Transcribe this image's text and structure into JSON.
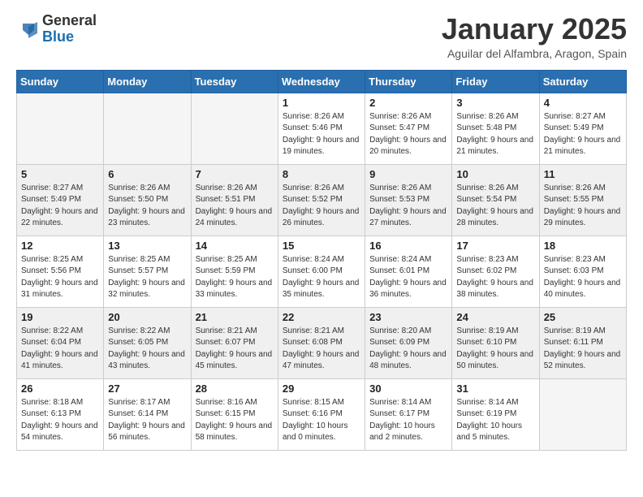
{
  "header": {
    "logo_general": "General",
    "logo_blue": "Blue",
    "month": "January 2025",
    "location": "Aguilar del Alfambra, Aragon, Spain"
  },
  "days_of_week": [
    "Sunday",
    "Monday",
    "Tuesday",
    "Wednesday",
    "Thursday",
    "Friday",
    "Saturday"
  ],
  "weeks": [
    [
      {
        "day": "",
        "empty": true
      },
      {
        "day": "",
        "empty": true
      },
      {
        "day": "",
        "empty": true
      },
      {
        "day": "1",
        "sunrise": "8:26 AM",
        "sunset": "5:46 PM",
        "daylight": "9 hours and 19 minutes."
      },
      {
        "day": "2",
        "sunrise": "8:26 AM",
        "sunset": "5:47 PM",
        "daylight": "9 hours and 20 minutes."
      },
      {
        "day": "3",
        "sunrise": "8:26 AM",
        "sunset": "5:48 PM",
        "daylight": "9 hours and 21 minutes."
      },
      {
        "day": "4",
        "sunrise": "8:27 AM",
        "sunset": "5:49 PM",
        "daylight": "9 hours and 21 minutes."
      }
    ],
    [
      {
        "day": "5",
        "sunrise": "8:27 AM",
        "sunset": "5:49 PM",
        "daylight": "9 hours and 22 minutes."
      },
      {
        "day": "6",
        "sunrise": "8:26 AM",
        "sunset": "5:50 PM",
        "daylight": "9 hours and 23 minutes."
      },
      {
        "day": "7",
        "sunrise": "8:26 AM",
        "sunset": "5:51 PM",
        "daylight": "9 hours and 24 minutes."
      },
      {
        "day": "8",
        "sunrise": "8:26 AM",
        "sunset": "5:52 PM",
        "daylight": "9 hours and 26 minutes."
      },
      {
        "day": "9",
        "sunrise": "8:26 AM",
        "sunset": "5:53 PM",
        "daylight": "9 hours and 27 minutes."
      },
      {
        "day": "10",
        "sunrise": "8:26 AM",
        "sunset": "5:54 PM",
        "daylight": "9 hours and 28 minutes."
      },
      {
        "day": "11",
        "sunrise": "8:26 AM",
        "sunset": "5:55 PM",
        "daylight": "9 hours and 29 minutes."
      }
    ],
    [
      {
        "day": "12",
        "sunrise": "8:25 AM",
        "sunset": "5:56 PM",
        "daylight": "9 hours and 31 minutes."
      },
      {
        "day": "13",
        "sunrise": "8:25 AM",
        "sunset": "5:57 PM",
        "daylight": "9 hours and 32 minutes."
      },
      {
        "day": "14",
        "sunrise": "8:25 AM",
        "sunset": "5:59 PM",
        "daylight": "9 hours and 33 minutes."
      },
      {
        "day": "15",
        "sunrise": "8:24 AM",
        "sunset": "6:00 PM",
        "daylight": "9 hours and 35 minutes."
      },
      {
        "day": "16",
        "sunrise": "8:24 AM",
        "sunset": "6:01 PM",
        "daylight": "9 hours and 36 minutes."
      },
      {
        "day": "17",
        "sunrise": "8:23 AM",
        "sunset": "6:02 PM",
        "daylight": "9 hours and 38 minutes."
      },
      {
        "day": "18",
        "sunrise": "8:23 AM",
        "sunset": "6:03 PM",
        "daylight": "9 hours and 40 minutes."
      }
    ],
    [
      {
        "day": "19",
        "sunrise": "8:22 AM",
        "sunset": "6:04 PM",
        "daylight": "9 hours and 41 minutes."
      },
      {
        "day": "20",
        "sunrise": "8:22 AM",
        "sunset": "6:05 PM",
        "daylight": "9 hours and 43 minutes."
      },
      {
        "day": "21",
        "sunrise": "8:21 AM",
        "sunset": "6:07 PM",
        "daylight": "9 hours and 45 minutes."
      },
      {
        "day": "22",
        "sunrise": "8:21 AM",
        "sunset": "6:08 PM",
        "daylight": "9 hours and 47 minutes."
      },
      {
        "day": "23",
        "sunrise": "8:20 AM",
        "sunset": "6:09 PM",
        "daylight": "9 hours and 48 minutes."
      },
      {
        "day": "24",
        "sunrise": "8:19 AM",
        "sunset": "6:10 PM",
        "daylight": "9 hours and 50 minutes."
      },
      {
        "day": "25",
        "sunrise": "8:19 AM",
        "sunset": "6:11 PM",
        "daylight": "9 hours and 52 minutes."
      }
    ],
    [
      {
        "day": "26",
        "sunrise": "8:18 AM",
        "sunset": "6:13 PM",
        "daylight": "9 hours and 54 minutes."
      },
      {
        "day": "27",
        "sunrise": "8:17 AM",
        "sunset": "6:14 PM",
        "daylight": "9 hours and 56 minutes."
      },
      {
        "day": "28",
        "sunrise": "8:16 AM",
        "sunset": "6:15 PM",
        "daylight": "9 hours and 58 minutes."
      },
      {
        "day": "29",
        "sunrise": "8:15 AM",
        "sunset": "6:16 PM",
        "daylight": "10 hours and 0 minutes."
      },
      {
        "day": "30",
        "sunrise": "8:14 AM",
        "sunset": "6:17 PM",
        "daylight": "10 hours and 2 minutes."
      },
      {
        "day": "31",
        "sunrise": "8:14 AM",
        "sunset": "6:19 PM",
        "daylight": "10 hours and 5 minutes."
      },
      {
        "day": "",
        "empty": true
      }
    ]
  ]
}
